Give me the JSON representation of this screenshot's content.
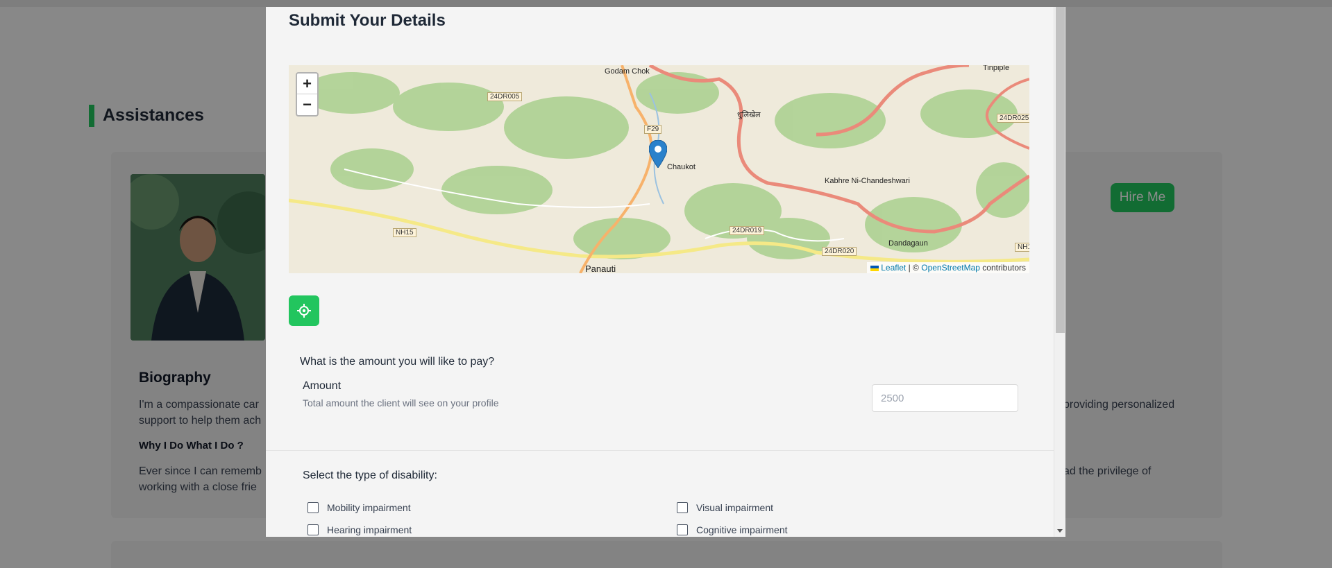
{
  "background": {
    "section_title": "Assistances",
    "hire_button": "Hire Me",
    "biography_title": "Biography",
    "biography_text_left": "I'm a compassionate car",
    "biography_text_left_2": "support to help them ach",
    "biography_text_right": "providing personalized",
    "why_title": "Why I Do What I Do ?",
    "why_text_left": "Ever since I can rememb",
    "why_text_left_2": "working with a close frie",
    "why_text_right": "ad the privilege of"
  },
  "modal": {
    "title": "Submit Your Details",
    "map": {
      "zoom_in": "+",
      "zoom_out": "−",
      "attribution_leaflet": "Leaflet",
      "attribution_sep": "| ©",
      "attribution_osm": "OpenStreetMap",
      "attribution_suffix": "contributors",
      "labels": {
        "godam_chok": "Godam Chok",
        "tinpiple": "Tinpiple",
        "dhulikhel": "धुलिखेल",
        "chaukot": "Chaukot",
        "kabhre": "Kabhre Ni-Chandeshwari",
        "dandagaun": "Dandagaun",
        "panauti": "Panauti"
      },
      "road_tags": {
        "r1": "24DR005",
        "r2": "F29",
        "r3": "24DR025",
        "r4": "NH15",
        "r5": "24DR019",
        "r6": "24DR020",
        "r7": "NH1"
      }
    },
    "question_amount": "What is the amount you will like to pay?",
    "amount_label": "Amount",
    "amount_help": "Total amount the client will see on your profile",
    "amount_placeholder": "2500",
    "question_disability": "Select the type of disability:",
    "disabilities": [
      "Mobility impairment",
      "Visual impairment",
      "Hearing impairment",
      "Cognitive impairment"
    ]
  }
}
